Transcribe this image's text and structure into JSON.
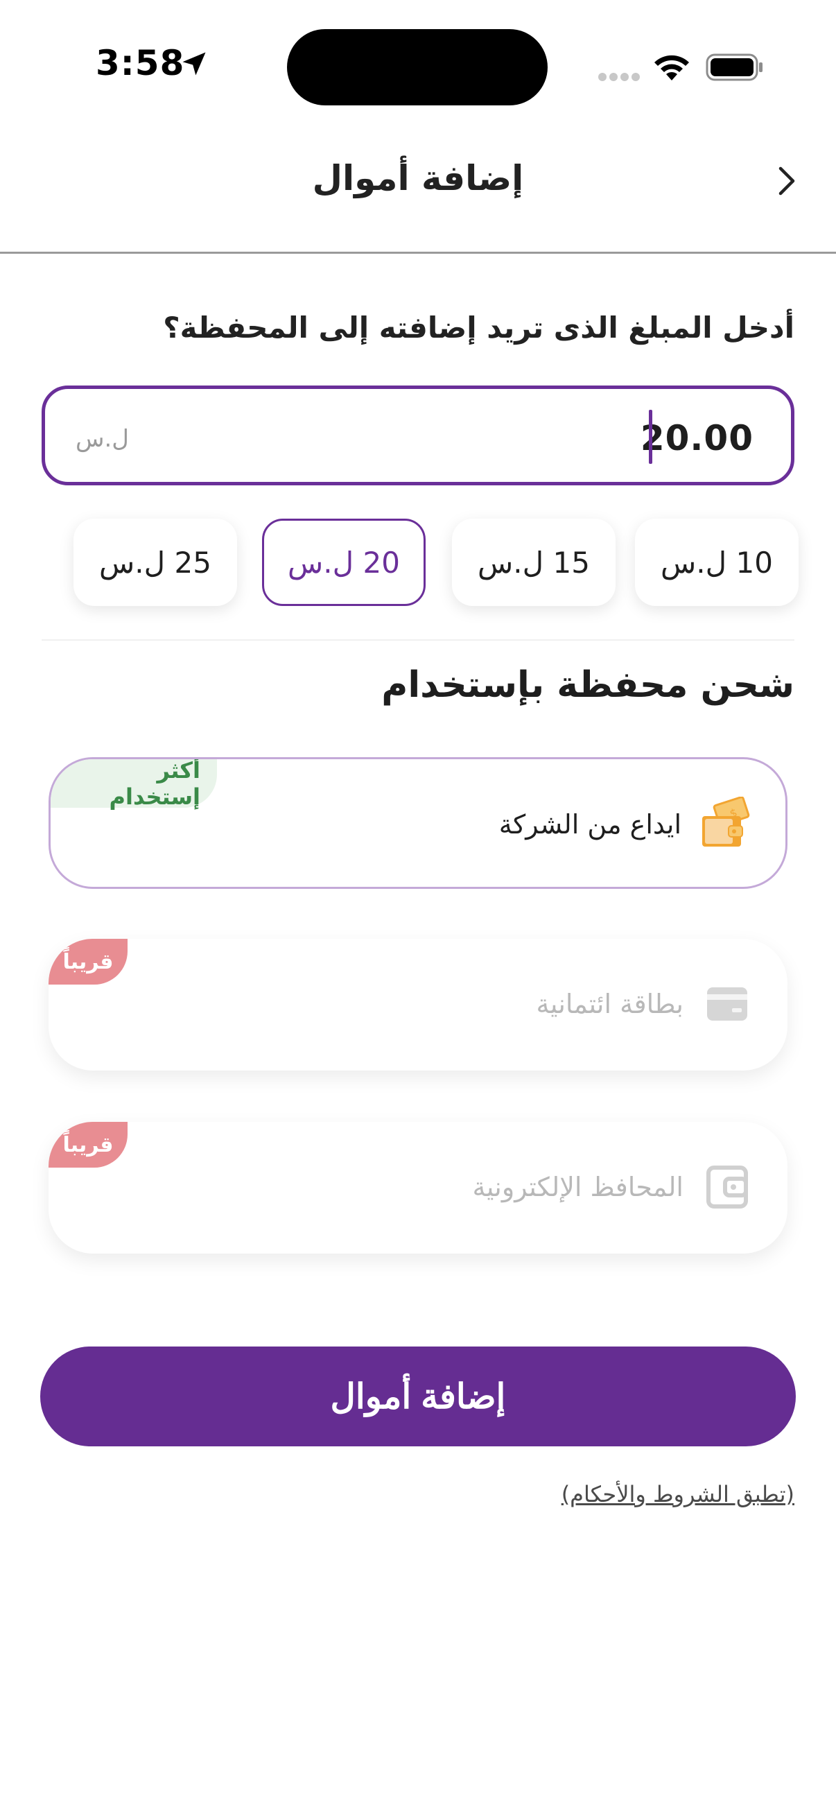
{
  "status_bar": {
    "time": "3:58"
  },
  "header": {
    "title": "إضافة أموال"
  },
  "amount": {
    "question": "أدخل المبلغ الذى تريد إضافته إلى المحفظة؟",
    "value": "20.00",
    "currency": "ل.س"
  },
  "quick_amounts": [
    {
      "label": "10 ل.س",
      "selected": false
    },
    {
      "label": "15 ل.س",
      "selected": false
    },
    {
      "label": "20 ل.س",
      "selected": true
    },
    {
      "label": "25 ل.س",
      "selected": false
    }
  ],
  "methods_section": {
    "title": "شحن محفظة بإستخدام",
    "items": [
      {
        "label": "ايداع من الشركة",
        "badge": "أكثر إستخدام",
        "icon": "wallet-cash-icon",
        "enabled": true
      },
      {
        "label": "بطاقة ائتمانية",
        "badge": "قريباً",
        "icon": "credit-card-icon",
        "enabled": false
      },
      {
        "label": "المحافظ الإلكترونية",
        "badge": "قريباً",
        "icon": "e-wallet-icon",
        "enabled": false
      }
    ]
  },
  "actions": {
    "submit_label": "إضافة أموال",
    "terms_label": "(تطبق الشروط والأحكام)"
  },
  "colors": {
    "brand": "#652d92",
    "popular_badge": "#3a8a48",
    "soon_badge": "#e88d92",
    "wallet_icon": "#f2a531"
  }
}
